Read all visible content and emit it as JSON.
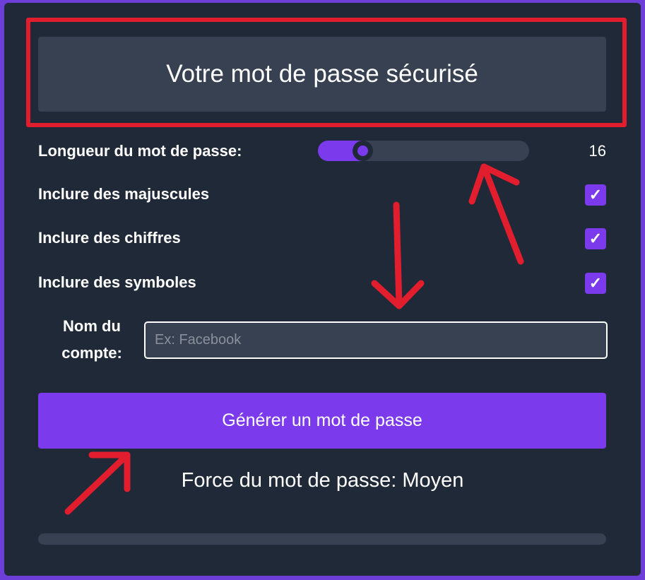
{
  "output": {
    "password_text": "Votre mot de passe sécurisé"
  },
  "options": {
    "length_label": "Longueur du mot de passe:",
    "length_value": "16",
    "length_slider": {
      "value": 16,
      "fill_fraction": 0.18
    },
    "uppercase_label": "Inclure des majuscules",
    "uppercase_checked": true,
    "digits_label": "Inclure des chiffres",
    "digits_checked": true,
    "symbols_label": "Inclure des symboles",
    "symbols_checked": true,
    "check_glyph": "✓"
  },
  "account": {
    "label_line1": "Nom du",
    "label_line2": "compte:",
    "placeholder": "Ex: Facebook",
    "value": ""
  },
  "actions": {
    "generate_label": "Générer un mot de passe"
  },
  "strength": {
    "text": "Force du mot de passe: Moyen",
    "level_fraction": 0
  },
  "colors": {
    "accent": "#7c3aed",
    "panel_bg": "#1f2937",
    "field_bg": "#374151",
    "annotation_red": "#e11d2e"
  },
  "icons": {
    "checkbox": "check-icon",
    "annotations": [
      "arrow-up-icon",
      "arrow-down-icon",
      "arrow-up-right-icon"
    ]
  }
}
